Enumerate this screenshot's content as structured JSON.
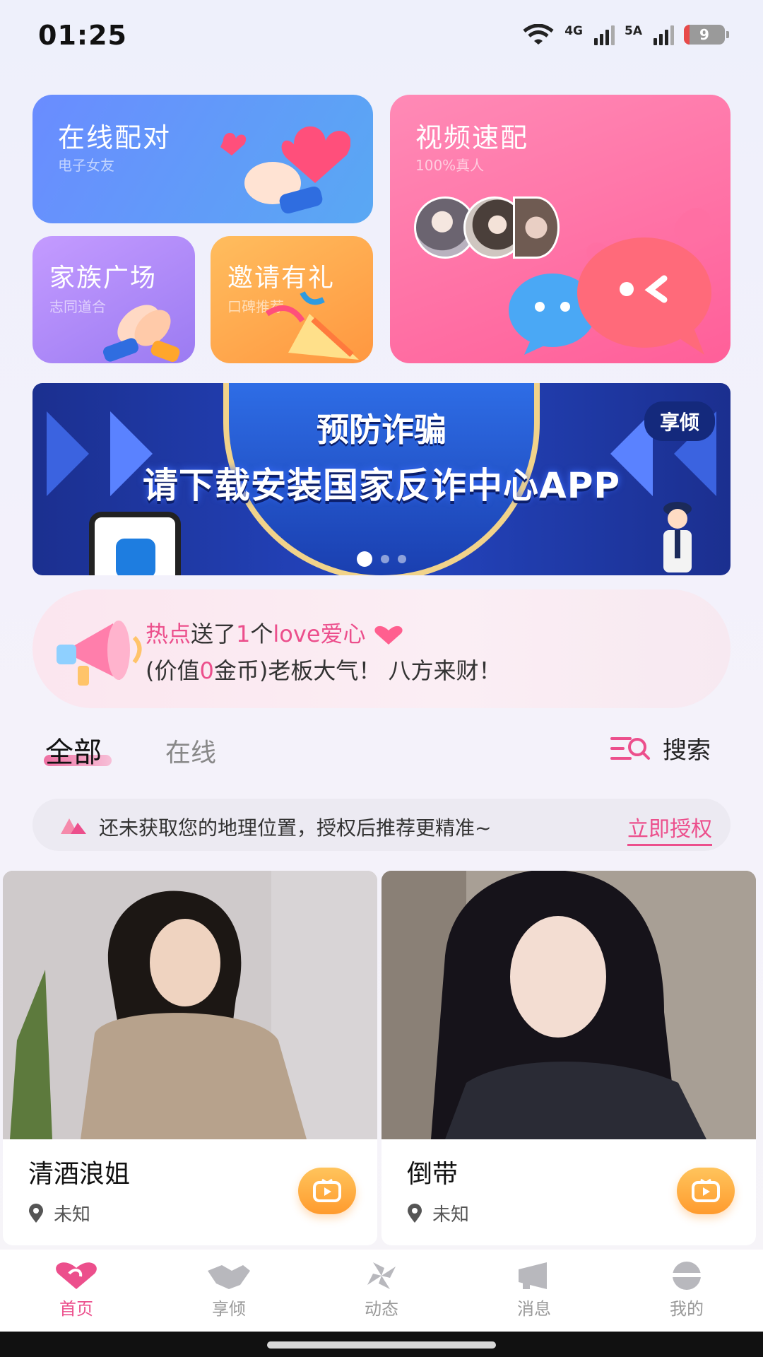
{
  "status_bar": {
    "time": "01:25",
    "net1": "4G",
    "net2": "5A",
    "battery": "9"
  },
  "features": {
    "online_match": {
      "title": "在线配对",
      "subtitle": "电子女友"
    },
    "video_match": {
      "title": "视频速配",
      "subtitle": "100%真人"
    },
    "family_square": {
      "title": "家族广场",
      "subtitle": "志同道合"
    },
    "invite": {
      "title": "邀请有礼",
      "subtitle": "口碑推荐"
    }
  },
  "banner": {
    "title": "预防诈骗",
    "subtitle": "请下载安装国家反诈中心APP",
    "badge": "享倾",
    "slides": 3,
    "active_slide": 1
  },
  "notice": {
    "hot": "热点",
    "sent": "送了",
    "count": "1",
    "unit": "个",
    "gift": "love爱心",
    "line2_a": "(价值",
    "value": "0",
    "line2_b": "金币)老板大气！ 八方来财！"
  },
  "tabs": {
    "all": "全部",
    "online": "在线",
    "search": "搜索"
  },
  "location_prompt": {
    "text": "还未获取您的地理位置，授权后推荐更精准~",
    "action": "立即授权"
  },
  "profiles": [
    {
      "name": "清酒浪姐",
      "location": "未知"
    },
    {
      "name": "倒带",
      "location": "未知"
    }
  ],
  "bottom_nav": [
    {
      "label": "首页",
      "icon": "heart-home-icon",
      "active": true
    },
    {
      "label": "享倾",
      "icon": "handshake-icon",
      "active": false
    },
    {
      "label": "动态",
      "icon": "pinwheel-icon",
      "active": false
    },
    {
      "label": "消息",
      "icon": "megaphone-icon",
      "active": false
    },
    {
      "label": "我的",
      "icon": "profile-icon",
      "active": false
    }
  ],
  "colors": {
    "accent": "#ec4f8c",
    "video_button": "#ff9b2e"
  }
}
